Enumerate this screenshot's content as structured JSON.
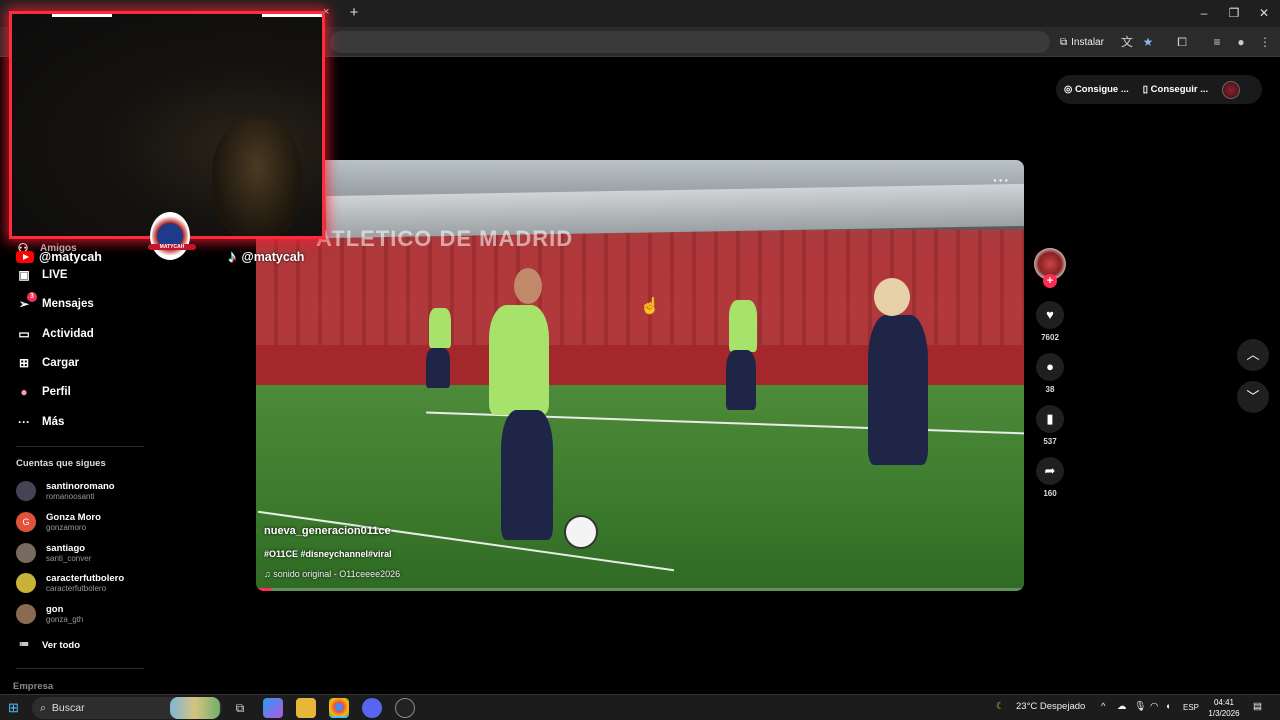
{
  "browser": {
    "install_label": "Instalar",
    "new_tab": "+",
    "close_tab": "×",
    "window_controls": [
      "–",
      "❐",
      "✕"
    ]
  },
  "overlay": {
    "youtube_handle": "@matycah",
    "tiktok_handle": "@matycah",
    "logo_text": "MATYCAH"
  },
  "sidebar": {
    "items": [
      {
        "label": "Amigos",
        "icon": "friends-icon"
      },
      {
        "label": "LIVE",
        "icon": "live-icon"
      },
      {
        "label": "Mensajes",
        "icon": "messages-icon",
        "badge": "3"
      },
      {
        "label": "Actividad",
        "icon": "activity-icon"
      },
      {
        "label": "Cargar",
        "icon": "upload-icon"
      },
      {
        "label": "Perfil",
        "icon": "profile-icon"
      },
      {
        "label": "Más",
        "icon": "more-icon"
      }
    ],
    "following_title": "Cuentas que sigues",
    "following": [
      {
        "name": "santinoromano",
        "handle": "romanoosanti"
      },
      {
        "name": "Gonza Moro",
        "handle": "gonzamoro",
        "initial": "G"
      },
      {
        "name": "santiago",
        "handle": "santi_conver"
      },
      {
        "name": "caracterfutbolero",
        "handle": "caracterfutbolero"
      },
      {
        "name": "gon",
        "handle": "gonza_gth"
      }
    ],
    "see_all": "Ver todo",
    "company": "Empresa"
  },
  "topbar": {
    "coins_label": "Consigue ...",
    "app_label": "Conseguir ..."
  },
  "video": {
    "author": "nueva_generacion011ce",
    "tags": "#O11CE #disneychannel#viral",
    "music": "sonido original - O11ceeee2026",
    "sign": "ATLETICO DE MADRID",
    "progress": 0.02
  },
  "actions": {
    "likes": "7602",
    "comments": "38",
    "saves": "537",
    "shares": "160"
  },
  "taskbar": {
    "search_placeholder": "Buscar",
    "weather": "23°C  Despejado",
    "language": "ESP",
    "time": "04:41",
    "date": "1/3/2026"
  },
  "colors": {
    "accent": "#fe2c55",
    "webcam_border": "#ff2a3a",
    "vest": "#a7e36b"
  }
}
